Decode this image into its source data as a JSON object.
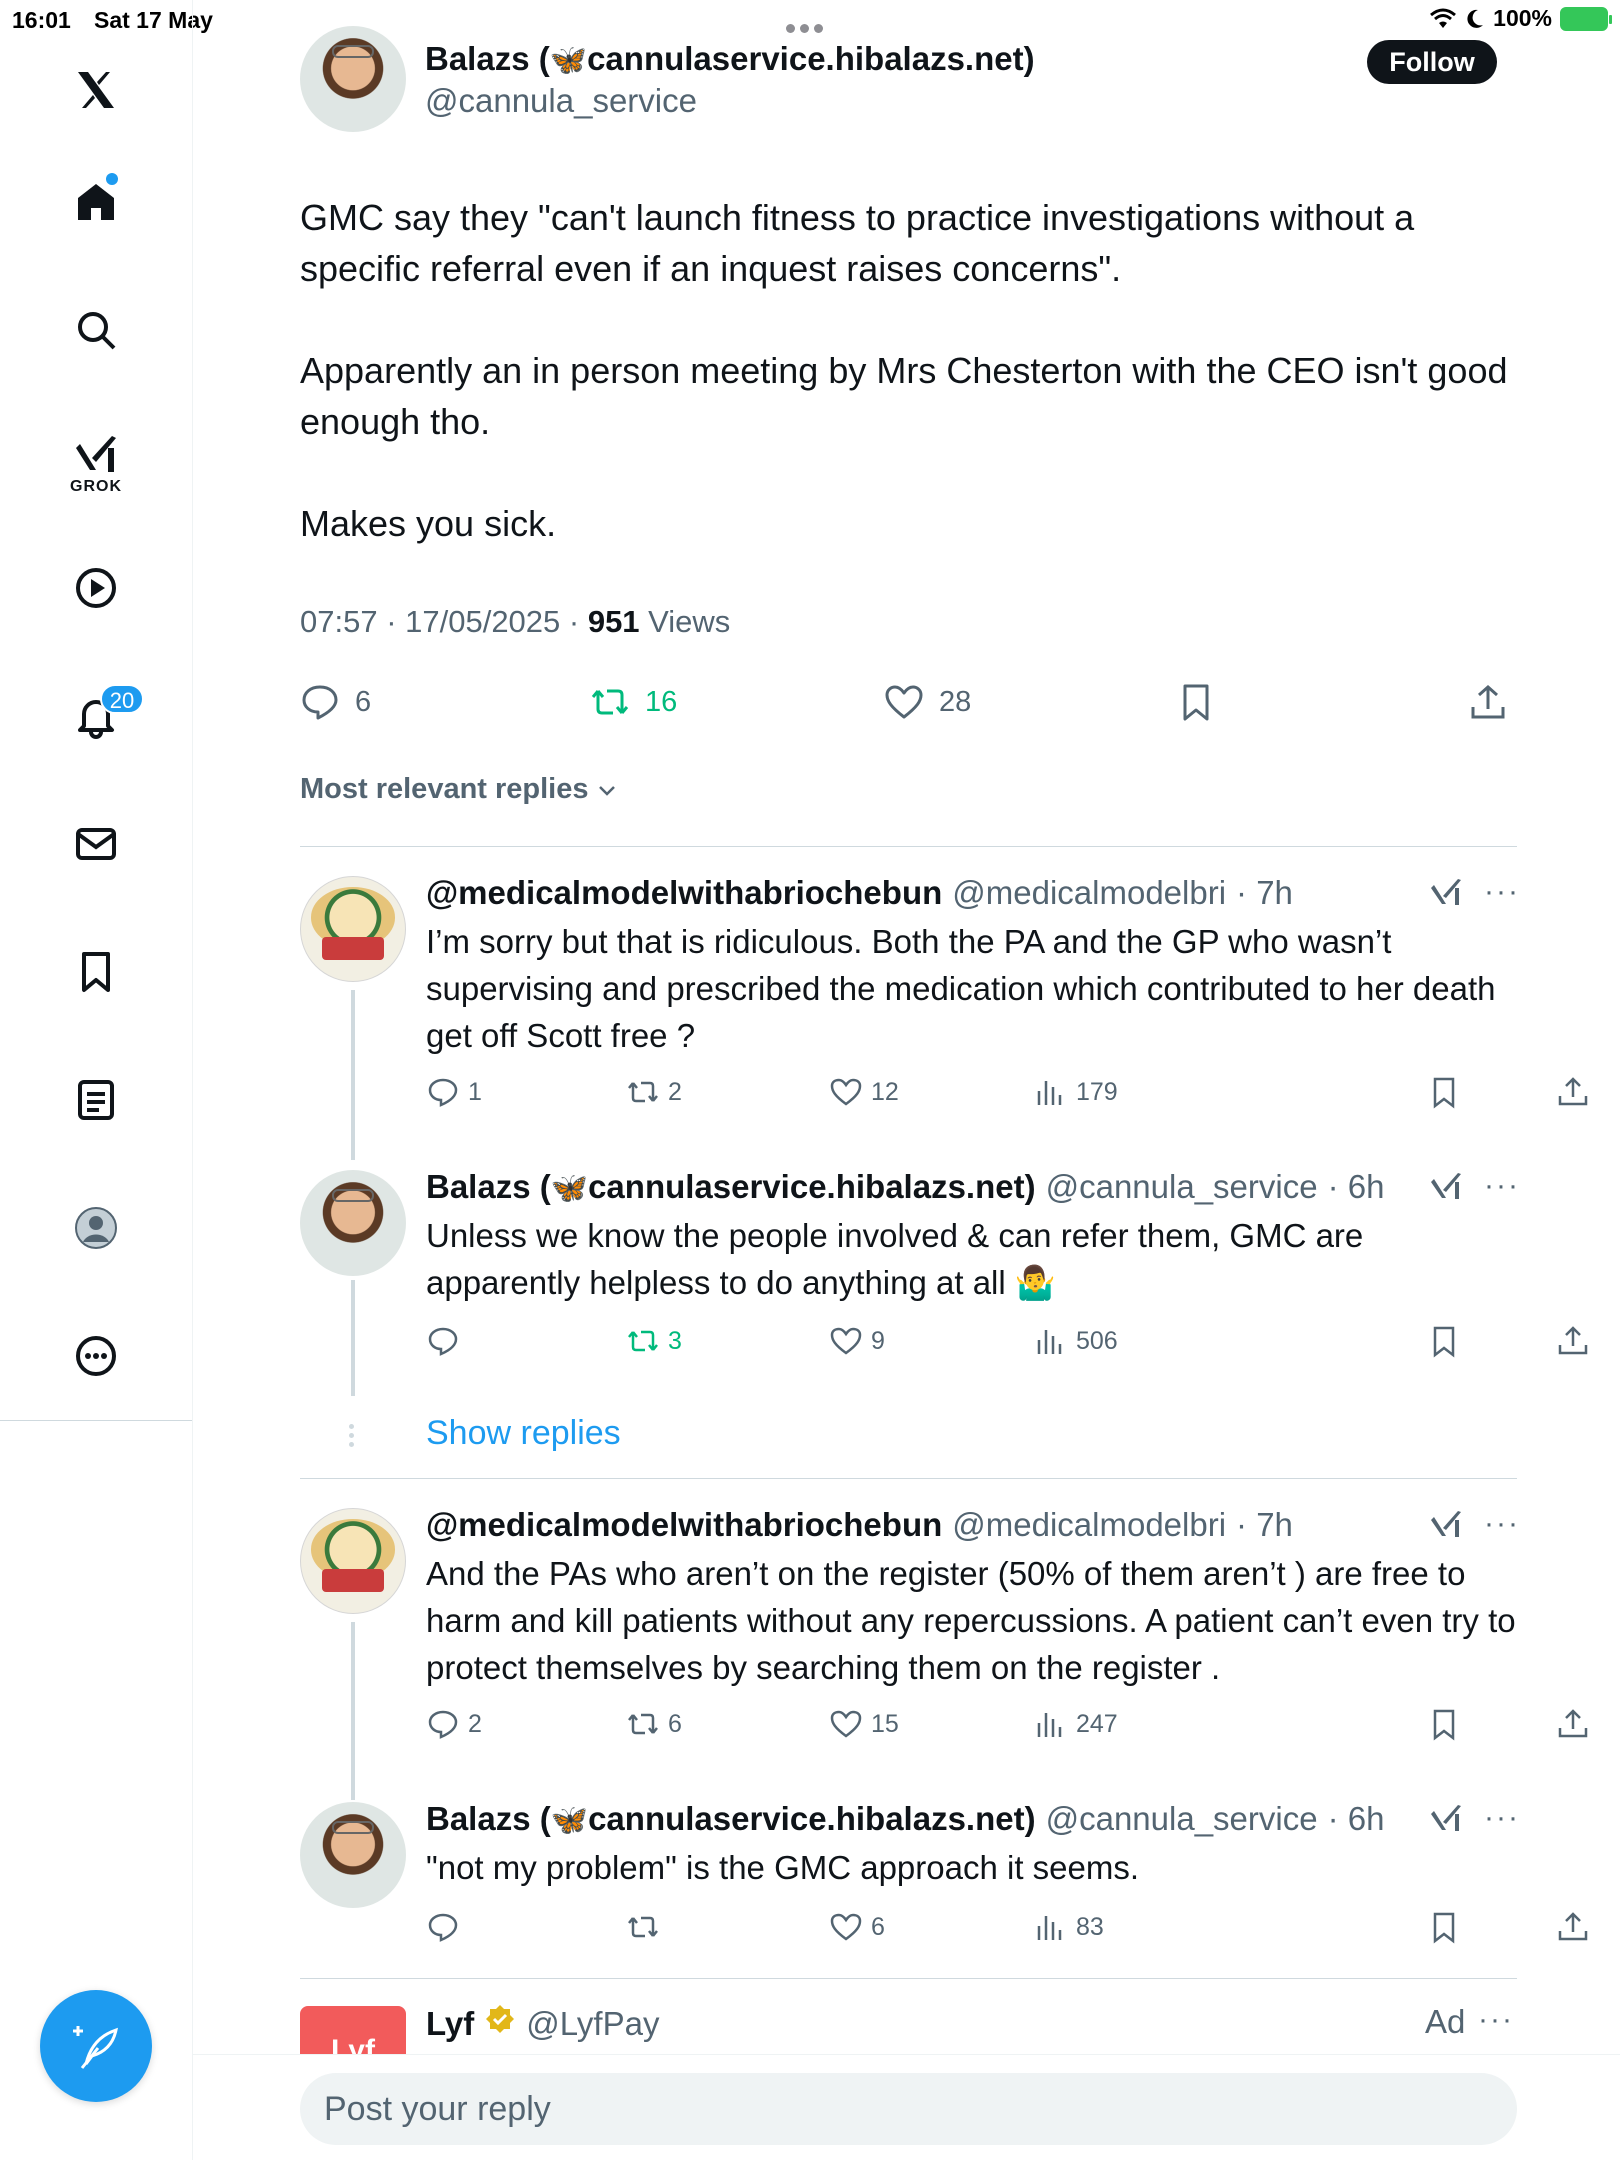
{
  "status_bar": {
    "time": "16:01",
    "date": "Sat 17 May",
    "battery": "100%"
  },
  "sidebar": {
    "items": [
      {
        "name": "x-logo-icon"
      },
      {
        "name": "home-icon"
      },
      {
        "name": "search-icon"
      },
      {
        "name": "grok-icon"
      },
      {
        "name": "video-icon"
      },
      {
        "name": "notifications-icon"
      },
      {
        "name": "messages-icon"
      },
      {
        "name": "bookmarks-icon"
      },
      {
        "name": "lists-icon"
      },
      {
        "name": "profile-icon"
      },
      {
        "name": "more-icon"
      }
    ],
    "grok_label": "GROK",
    "notifications_count": "20"
  },
  "post": {
    "author_name": "Balazs (",
    "author_domain": "cannulaservice.hibalazs.net)",
    "author_handle": "@cannula_service",
    "follow_label": "Follow",
    "paragraphs": [
      "GMC say they \"can't launch fitness to practice investigations without a specific referral even if an inquest raises concerns\".",
      "Apparently an in person meeting by Mrs Chesterton with the CEO isn't good enough tho.",
      "Makes you sick."
    ],
    "time": "07:57 · 17/05/2025 · ",
    "views_count": "951",
    "views_label": " Views",
    "replies": "6",
    "reposts": "16",
    "likes": "28"
  },
  "replies_sort_label": "Most relevant replies",
  "replies": [
    {
      "name": "@medicalmodelwithabriochebun",
      "handle": "@medicalmodelbri",
      "time": "· 7h",
      "text": "I’m sorry but that is ridiculous. Both the PA and the GP who wasn’t supervising and prescribed the medication which contributed to her death get off Scott free ?",
      "replies": "1",
      "reposts": "2",
      "likes": "12",
      "views": "179"
    },
    {
      "name": "Balazs (",
      "domain": "cannulaservice.hibalazs.net)",
      "handle": "@cannula_service",
      "time": "· 6h",
      "text": "Unless we know the people involved & can refer them, GMC are apparently helpless to do anything at all 🤷‍♂️",
      "replies": "",
      "reposts": "3",
      "likes": "9",
      "views": "506"
    },
    {
      "name": "@medicalmodelwithabriochebun",
      "handle": "@medicalmodelbri",
      "time": "· 7h",
      "text": "And the PAs who aren’t on the register (50% of them aren’t ) are free to harm and kill patients without any repercussions. A patient can’t even try to protect themselves by searching them on the register .",
      "replies": "2",
      "reposts": "6",
      "likes": "15",
      "views": "247"
    },
    {
      "name": "Balazs (",
      "domain": "cannulaservice.hibalazs.net)",
      "handle": "@cannula_service",
      "time": "· 6h",
      "text": "\"not my problem\" is the GMC approach it seems.",
      "replies": "",
      "reposts": "",
      "likes": "6",
      "views": "83"
    }
  ],
  "show_replies_label": "Show replies",
  "ad": {
    "name": "Lyf",
    "handle": "@LyfPay",
    "label": "Ad",
    "avatar_text": "Lyf"
  },
  "reply_placeholder": "Post your reply",
  "colors": {
    "accent": "#1d9bf0",
    "repost_green": "#00ba7c",
    "text": "#0f1419",
    "muted": "#536471"
  }
}
